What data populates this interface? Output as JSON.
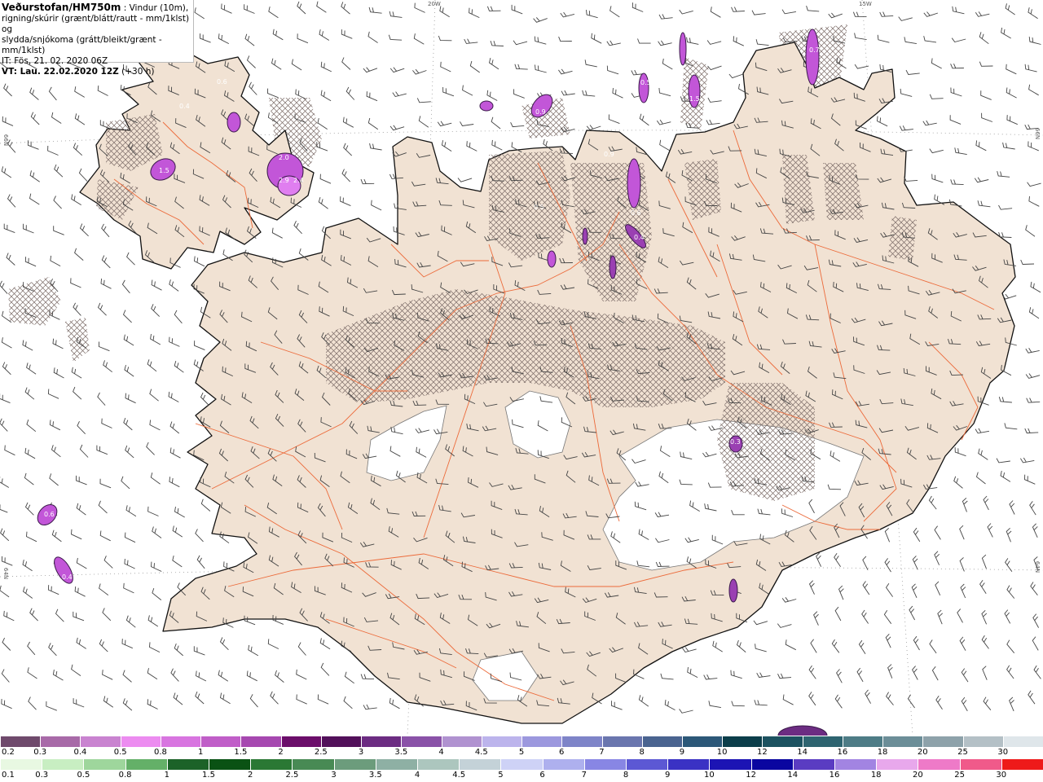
{
  "header": {
    "title": "Veðurstofan/HM750m",
    "desc_line1": ": Vindur (10m),",
    "desc_line2": "rigning/skúrir (grænt/blátt/rautt - mm/1klst) og",
    "desc_line3": "slydda/snjókoma (grátt/bleikt/grænt - mm/1klst)",
    "it": "IT: Fös. 21. 02. 2020 06Z",
    "vt": "VT: Lau. 22.02.2020 12Z",
    "vt_offset": "(+30 h)"
  },
  "grid_labels": {
    "lon_20w": "20W",
    "lon_15w": "15W",
    "lat_66_left": "66N",
    "lat_66_right": "66N",
    "lat_64_left": "64N",
    "lat_64_right": "64N"
  },
  "precip_values": [
    "0.6",
    "0.4",
    "1.5",
    "2.0",
    "2.9",
    "2.4",
    "0.9",
    "0.7",
    "0.5",
    "1.5",
    "0.9",
    "0.6",
    "0.3",
    "0.6",
    "0.4",
    "0.5",
    "0.4"
  ],
  "legend": {
    "snow": {
      "labels": [
        "0.2",
        "0.3",
        "0.4",
        "0.5",
        "0.8",
        "1",
        "1.5",
        "2",
        "2.5",
        "3",
        "3.5",
        "4",
        "4.5",
        "5",
        "6",
        "7",
        "8",
        "9",
        "10",
        "12",
        "14",
        "16",
        "18",
        "20",
        "25",
        "30"
      ],
      "colors": [
        "#6f4a6c",
        "#a86aa8",
        "#c983d0",
        "#ec8cf0",
        "#d875e0",
        "#c05ec8",
        "#a648b0",
        "#6b0e6a",
        "#52105a",
        "#6c2c82",
        "#8a52a8",
        "#b092d0",
        "#bcb4ec",
        "#9c98de",
        "#7e84c8",
        "#6a76ae",
        "#4a6490",
        "#2c5878",
        "#0c3e4a",
        "#1c5260",
        "#2e6470",
        "#4e7c86",
        "#6c8e98",
        "#8ea2aa",
        "#b4c0c6",
        "#dfe6ea"
      ]
    },
    "rain": {
      "labels": [
        "0.1",
        "0.3",
        "0.5",
        "0.8",
        "1",
        "1.5",
        "2",
        "2.5",
        "3",
        "3.5",
        "4",
        "4.5",
        "5",
        "6",
        "7",
        "8",
        "9",
        "10",
        "12",
        "14",
        "16",
        "18",
        "20",
        "25",
        "30"
      ],
      "colors": [
        "#e8f8e2",
        "#c8eec2",
        "#9ed69c",
        "#64b068",
        "#1c6228",
        "#0a5214",
        "#2a7834",
        "#488a54",
        "#6c9c7c",
        "#8eb0a4",
        "#acc6be",
        "#c4d2d8",
        "#ced2f6",
        "#aeb0ee",
        "#8886e4",
        "#5c58d4",
        "#3a32c4",
        "#1c14b4",
        "#0a06a0",
        "#5a3cc2",
        "#a284e2",
        "#e8a8ec",
        "#ee7ac8",
        "#f05a8a",
        "#ee1a1a"
      ]
    }
  }
}
